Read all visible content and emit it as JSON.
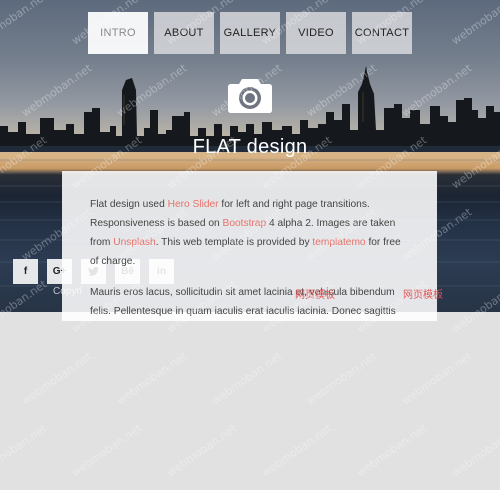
{
  "nav": {
    "items": [
      {
        "label": "INTRO",
        "active": true
      },
      {
        "label": "ABOUT",
        "active": false
      },
      {
        "label": "GALLERY",
        "active": false
      },
      {
        "label": "VIDEO",
        "active": false
      },
      {
        "label": "CONTACT",
        "active": false
      }
    ]
  },
  "hero": {
    "icon": "camera-icon",
    "title": "FLAT design"
  },
  "content": {
    "p1_a": "Flat design used ",
    "link_hero": "Hero Slider",
    "p1_b": " for left and right page transitions. Responsiveness is based on ",
    "link_bootstrap": "Bootstrap",
    "p1_c": " 4 alpha 2. Images are taken from ",
    "link_unsplash": "Unsplash",
    "p1_d": ". This web template is provided by ",
    "link_templatemo": "templatemo",
    "p1_e": " for free of charge.",
    "p2": "Mauris eros lacus, sollicitudin sit amet lacinia et, vehicula bibendum felis. Pellentesque in quam iaculis erat iaculis lacinia. Donec sagittis"
  },
  "social": {
    "items": [
      {
        "label": "f",
        "icon": "facebook-icon"
      },
      {
        "label": "G+",
        "icon": "google-plus-icon"
      },
      {
        "label": "",
        "icon": "twitter-icon"
      },
      {
        "label": "Bē",
        "icon": "behance-icon"
      },
      {
        "label": "in",
        "icon": "linkedin-icon"
      }
    ]
  },
  "footer": {
    "copyright": "Copyri",
    "link1": "网页模板",
    "link2": "网页模板"
  },
  "watermark": {
    "text": "webmoban.net"
  },
  "colors": {
    "link": "#e8736b",
    "footer_link": "#e25555",
    "page_bg": "#e1e1e1"
  }
}
